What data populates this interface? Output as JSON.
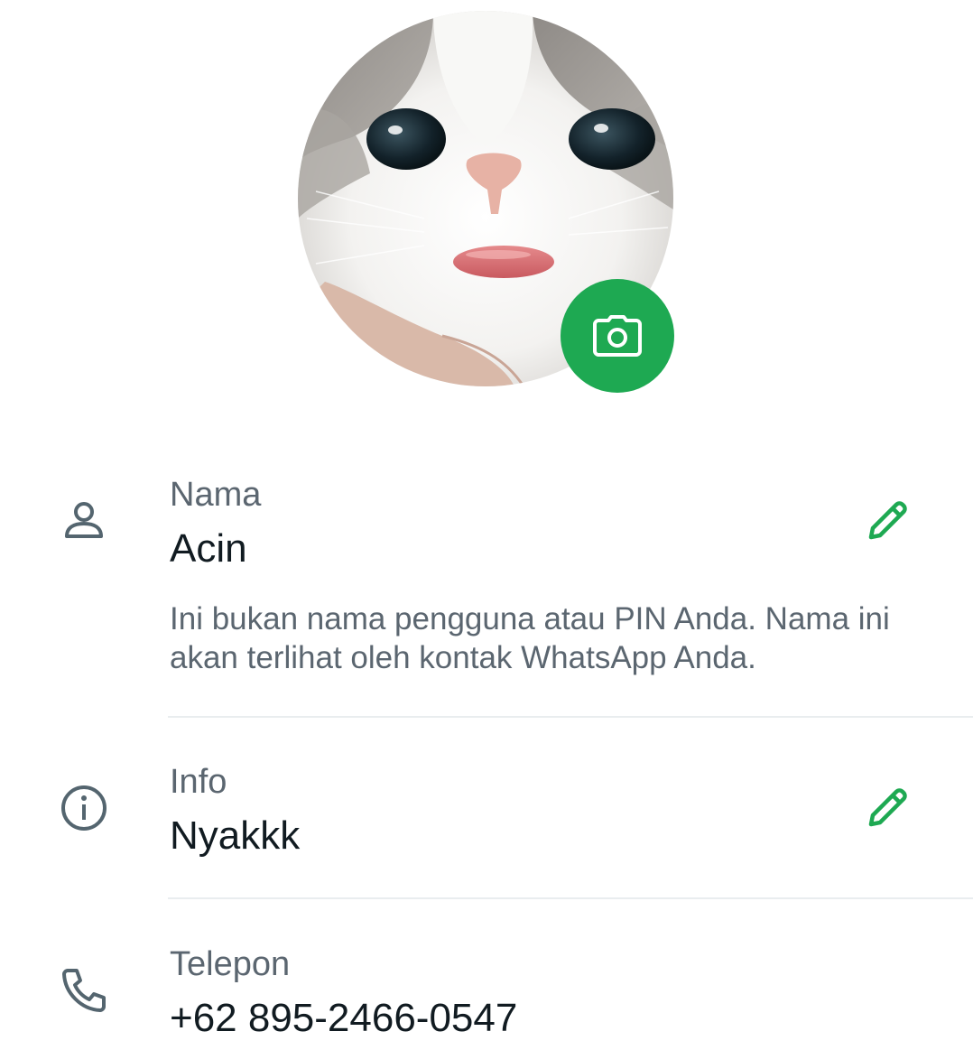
{
  "profile": {
    "camera_icon": "camera-icon"
  },
  "name_row": {
    "icon": "person-icon",
    "label": "Nama",
    "value": "Acin",
    "help": "Ini bukan nama pengguna atau PIN Anda. Nama ini akan terlihat oleh kontak WhatsApp Anda.",
    "edit_icon": "pencil-icon"
  },
  "about_row": {
    "icon": "info-icon",
    "label": "Info",
    "value": "Nyakkk",
    "edit_icon": "pencil-icon"
  },
  "phone_row": {
    "icon": "phone-icon",
    "label": "Telepon",
    "value": "+62 895-2466-0547"
  },
  "colors": {
    "accent": "#1ea952",
    "label": "#5b6670",
    "text": "#111b21",
    "icon": "#54656f",
    "divider": "#e9edef"
  }
}
